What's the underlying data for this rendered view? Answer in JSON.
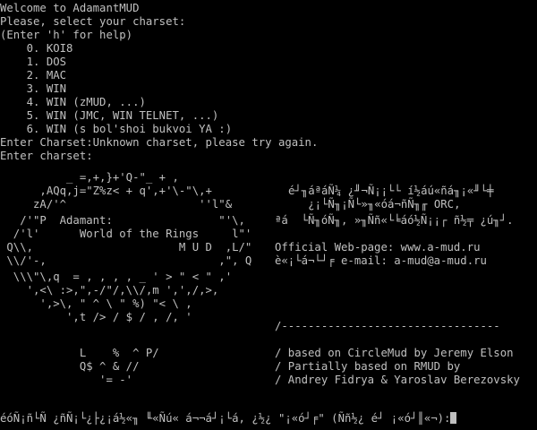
{
  "terminal": {
    "welcome": "Welcome to AdamantMUD",
    "select_prompt": "Please, select your charset:",
    "help_hint": "(Enter 'h' for help)",
    "charsets": [
      "    0. KOI8",
      "    1. DOS",
      "    2. MAC",
      "    3. WIN",
      "    4. WIN (zMUD, ...)",
      "    5. WIN (JMC, WIN TELNET, ...)",
      "    6. WIN (s bol'shoi bukvoi YA :)"
    ],
    "error_line": "Enter Charset:Unknown charset, please try again.",
    "enter_prompt": "Enter charset:",
    "art": [
      "          _ =,+,}+'Q-\"_ + ,",
      "      ,AQq,j=\"Z%z< + q',+'\\-\"\\,+",
      "     zA/'^                    ''l\"&",
      "   /'\"P  Adamant:                \"'\\,",
      "  /'l'      World of the Rings     l\"'",
      " Q\\\\,                      M U D  ,L/\"",
      " \\\\/'-,                          ,\", Q",
      "  \\\\\\\"\\,q  = , , , , _ ' > \" < \" ,'",
      "    ',<\\ :>,\",-/\"/,\\\\/,m ',',/,>,",
      "      ',>\\, \" ^ \\ \" %) \"< \\ ,",
      "          ',t /> / $ / , /, '",
      "",
      "            L    %  ^ P/",
      "            Q$ ^ & //",
      "               '= -'"
    ],
    "right_top": [
      "é┘╖áªáÑ¼ ¿╜¬Ñ¡¡└└ í½áú«ñá╖¡«╜└╪",
      "   ¿¡└Ñ╖¡Ñ└»╖«óá¬ñÑ╖╓ ORC,",
      "ªá  └Ñ╖óÑ╖, »╖Ññ«└╘áó½Ñ¡¡┌ ñ½╤ ¿ú╖┘."
    ],
    "webpage_line": "Official Web-page: www.a-mud.ru",
    "email_line": "è«¡└á¬└┘╒ e-mail: a-mud@a-mud.ru",
    "divider": "/---------------------------------",
    "credits": [
      "/ based on CircleMud by Jeremy Elson",
      "/ Partially based on RMUD by",
      "/ Andrey Fidrya & Yaroslav Berezovsky"
    ],
    "bottom_prompt": "éóÑ¡ñ└Ñ ¿ñÑ¡└¿├¿¡á½«╖ ╙«Ñú« á¬¬á┘¡└á, ¿½¿ \"¡«ó┘╒\" (Ññ½¿ é┘ ¡«ó┘║«¬):",
    "colors": {
      "background": "#000000",
      "foreground": "#c0c0c0"
    }
  }
}
